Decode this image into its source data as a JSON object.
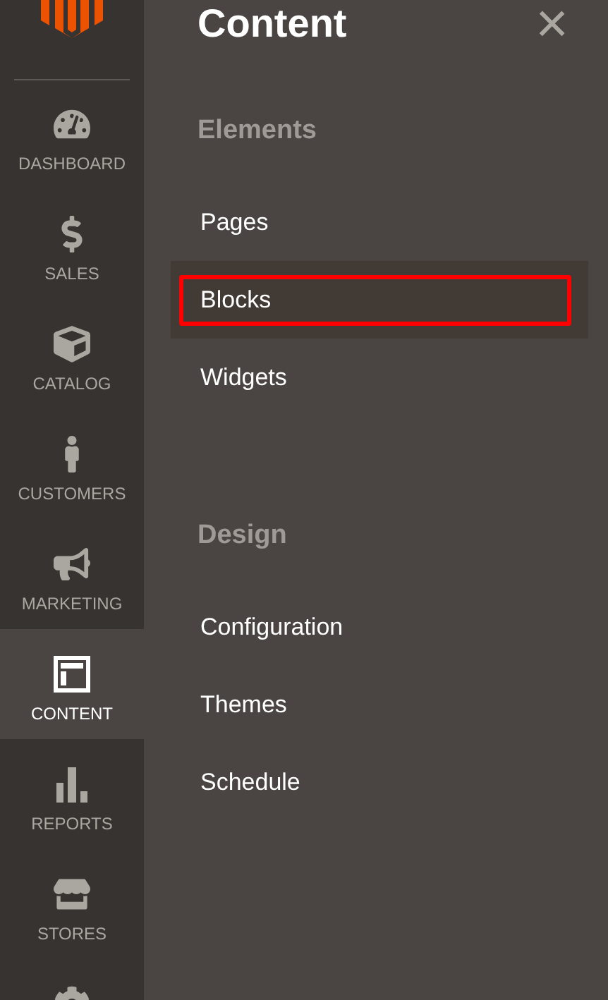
{
  "sidebar": {
    "items": [
      {
        "label": "DASHBOARD",
        "selected": false
      },
      {
        "label": "SALES",
        "selected": false
      },
      {
        "label": "CATALOG",
        "selected": false
      },
      {
        "label": "CUSTOMERS",
        "selected": false
      },
      {
        "label": "MARKETING",
        "selected": false
      },
      {
        "label": "CONTENT",
        "selected": true
      },
      {
        "label": "REPORTS",
        "selected": false
      },
      {
        "label": "STORES",
        "selected": false
      },
      {
        "selected": false
      }
    ]
  },
  "panel": {
    "title": "Content",
    "close": "×",
    "sections": [
      {
        "heading": "Elements",
        "items": [
          {
            "label": "Pages",
            "selected": false,
            "outlined": false
          },
          {
            "label": "Blocks",
            "selected": true,
            "outlined": true
          },
          {
            "label": "Widgets",
            "selected": false,
            "outlined": false
          }
        ]
      },
      {
        "heading": "Design",
        "items": [
          {
            "label": "Configuration",
            "selected": false,
            "outlined": false
          },
          {
            "label": "Themes",
            "selected": false,
            "outlined": false
          },
          {
            "label": "Schedule",
            "selected": false,
            "outlined": false
          }
        ]
      }
    ]
  }
}
